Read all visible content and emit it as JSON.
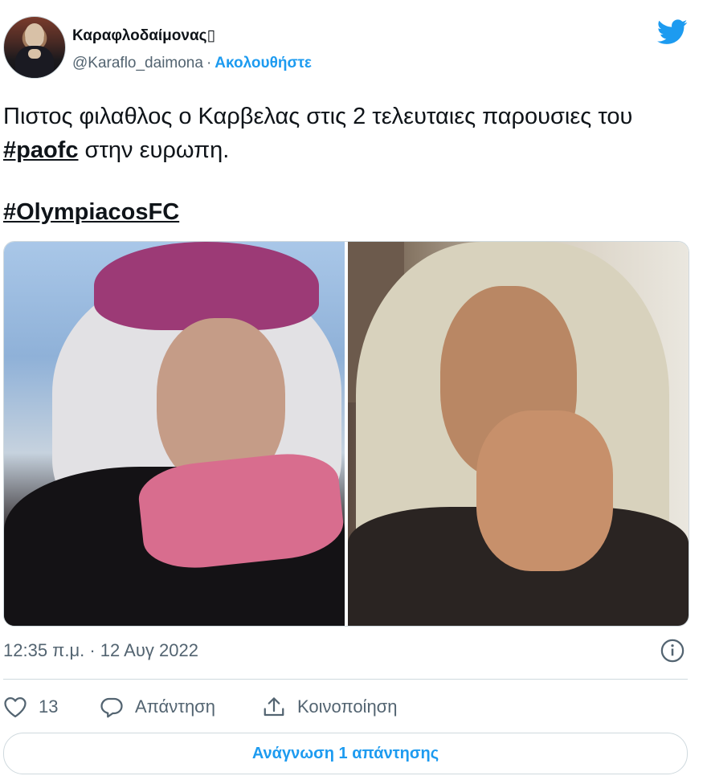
{
  "author": {
    "display_name": "Καραφλοδαίμονας▯",
    "handle": "@Karaflo_daimona",
    "separator": "·",
    "follow_label": "Ακολουθήστε"
  },
  "tweet": {
    "text_part1": "Πιστος φιλαθλος ο Καρβελας στις 2 τελευταιες παρουσιες του ",
    "hashtag1": "#paofc",
    "text_part2": " στην ευρωπη.",
    "hashtag2": "#OlympiacosFC"
  },
  "timestamp": "12:35 π.μ. · 12 Αυγ 2022",
  "actions": {
    "like_count": "13",
    "reply_label": "Απάντηση",
    "share_label": "Κοινοποίηση"
  },
  "read_replies_label": "Ανάγνωση 1 απάντησης",
  "colors": {
    "accent": "#1d9bf0",
    "text": "#0f1419",
    "muted": "#536471",
    "border": "#cfd9de"
  },
  "icons": [
    "twitter-bird-icon",
    "info-icon",
    "heart-icon",
    "reply-icon",
    "share-icon"
  ]
}
